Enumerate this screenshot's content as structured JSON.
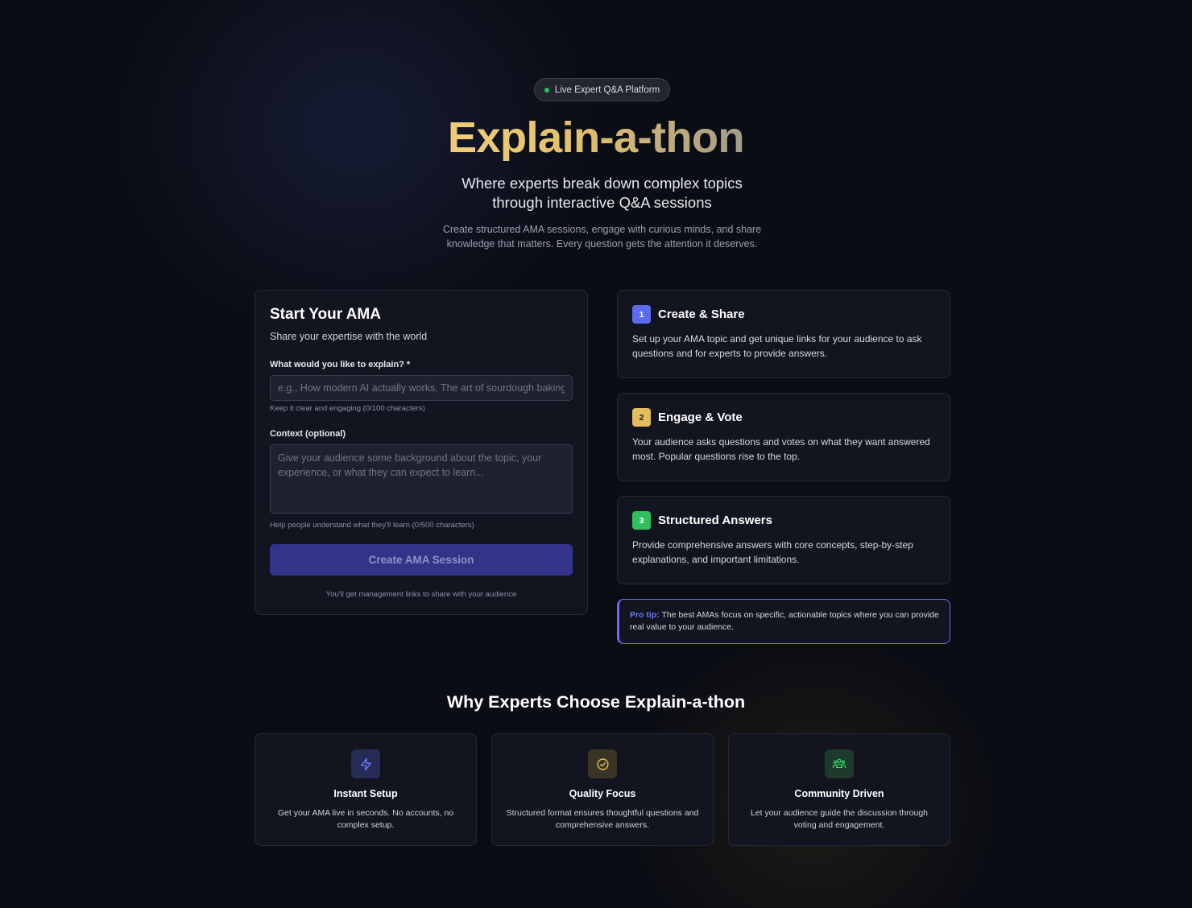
{
  "hero": {
    "badge": "Live Expert Q&A Platform",
    "title": "Explain-a-thon",
    "subtitle": "Where experts break down complex topics through interactive Q&A sessions",
    "description": "Create structured AMA sessions, engage with curious minds, and share knowledge that matters. Every question gets the attention it deserves."
  },
  "form": {
    "title": "Start Your AMA",
    "subtitle": "Share your expertise with the world",
    "topic_label": "What would you like to explain? *",
    "topic_placeholder": "e.g., How modern AI actually works, The art of sourdough baking",
    "topic_value": "",
    "topic_hint": "Keep it clear and engaging (0/100 characters)",
    "context_label": "Context (optional)",
    "context_placeholder": "Give your audience some background about the topic, your experience, or what they can expect to learn...",
    "context_value": "",
    "context_hint": "Help people understand what they'll learn (0/500 characters)",
    "submit_label": "Create AMA Session",
    "note": "You'll get management links to share with your audience"
  },
  "steps": [
    {
      "number": "1",
      "title": "Create & Share",
      "text": "Set up your AMA topic and get unique links for your audience to ask questions and for experts to provide answers.",
      "color": "#6b78f5"
    },
    {
      "number": "2",
      "title": "Engage & Vote",
      "text": "Your audience asks questions and votes on what they want answered most. Popular questions rise to the top.",
      "color": "#e9c46a"
    },
    {
      "number": "3",
      "title": "Structured Answers",
      "text": "Provide comprehensive answers with core concepts, step-by-step explanations, and important limitations.",
      "color": "#3ecf6e"
    }
  ],
  "protip": {
    "label": "Pro tip:",
    "text": " The best AMAs focus on specific, actionable topics where you can provide real value to your audience."
  },
  "why": {
    "title": "Why Experts Choose Explain-a-thon",
    "features": [
      {
        "icon": "lightning-icon",
        "title": "Instant Setup",
        "text": "Get your AMA live in seconds. No accounts, no complex setup.",
        "color": "#6b78f5"
      },
      {
        "icon": "check-circle-icon",
        "title": "Quality Focus",
        "text": "Structured format ensures thoughtful questions and comprehensive answers.",
        "color": "#e9c46a"
      },
      {
        "icon": "community-icon",
        "title": "Community Driven",
        "text": "Let your audience guide the discussion through voting and engagement.",
        "color": "#3ecf6e"
      }
    ]
  }
}
